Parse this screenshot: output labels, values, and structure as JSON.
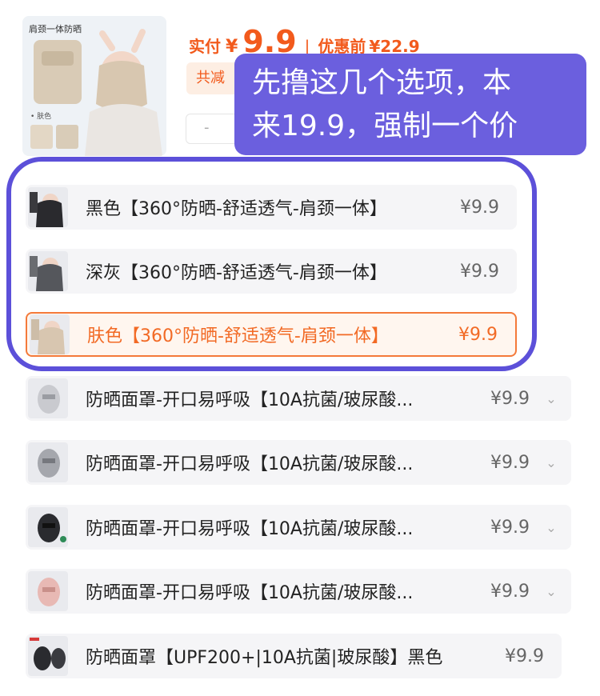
{
  "product": {
    "thumb_title": "肩颈一体防晒",
    "thumb_color_tag": "• 肤色",
    "pay_label": "实付",
    "pay_yen": "¥",
    "pay_amount": "9.9",
    "separator": "|",
    "orig_label": "优惠前",
    "orig_amount": "¥22.9",
    "discount_chip": "共减",
    "qty_minus": "-"
  },
  "callout": {
    "line1": "先撸这几个选项，本",
    "line2": "来19.9，强制一个价",
    "color": "#6b5fde"
  },
  "options": [
    {
      "label": "黑色【360°防晒-舒适透气-肩颈一体】",
      "price": "¥9.9",
      "selected": false,
      "has_chevron": false,
      "icon": "black-mask-thumbnail"
    },
    {
      "label": "深灰【360°防晒-舒适透气-肩颈一体】",
      "price": "¥9.9",
      "selected": false,
      "has_chevron": false,
      "icon": "gray-mask-thumbnail"
    },
    {
      "label": "肤色【360°防晒-舒适透气-肩颈一体】",
      "price": "¥9.9",
      "selected": true,
      "has_chevron": false,
      "icon": "skin-mask-thumbnail"
    },
    {
      "label": "防晒面罩-开口易呼吸【10A抗菌/玻尿酸...",
      "price": "¥9.9",
      "selected": false,
      "has_chevron": true,
      "chevron": "⌄",
      "icon": "face-mask-thumbnail"
    },
    {
      "label": "防晒面罩-开口易呼吸【10A抗菌/玻尿酸...",
      "price": "¥9.9",
      "selected": false,
      "has_chevron": true,
      "chevron": "⌄",
      "icon": "face-mask-thumbnail"
    },
    {
      "label": "防晒面罩-开口易呼吸【10A抗菌/玻尿酸...",
      "price": "¥9.9",
      "selected": false,
      "has_chevron": true,
      "chevron": "⌄",
      "icon": "black-face-mask-thumbnail"
    },
    {
      "label": "防晒面罩-开口易呼吸【10A抗菌/玻尿酸...",
      "price": "¥9.9",
      "selected": false,
      "has_chevron": true,
      "chevron": "⌄",
      "icon": "pink-face-mask-thumbnail"
    },
    {
      "label": "防晒面罩【UPF200+|10A抗菌|玻尿酸】黑色",
      "price": "¥9.9",
      "selected": false,
      "has_chevron": false,
      "icon": "black-face-mask-thumbnail"
    }
  ],
  "colors": {
    "accent": "#f25a1c",
    "selected_border": "#f47a3a",
    "annotation_circle": "#5c50d9"
  }
}
